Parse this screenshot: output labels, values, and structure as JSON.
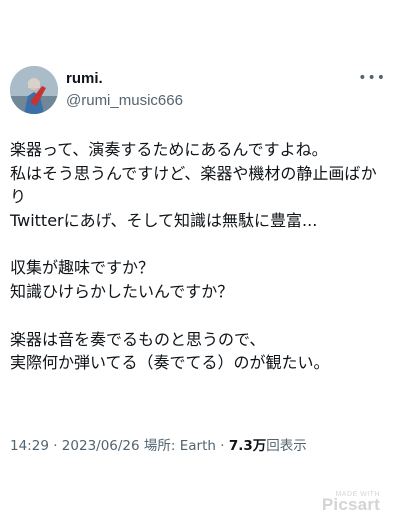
{
  "author": {
    "display_name": "rumi.",
    "handle": "@rumi_music666"
  },
  "more_icon": "ellipsis-icon",
  "tweet": {
    "lines": [
      "楽器って、演奏するためにあるんですよね。",
      "私はそう思うんですけど、楽器や機材の静止画ばか",
      "り",
      "Twitterにあげ、そして知識は無駄に豊富...",
      "",
      "収集が趣味ですか？",
      "知識ひけらかしたいんですか？",
      "",
      "楽器は音を奏でるものと思うので、",
      "実際何か弾いてる（奏でてる）のが観たい。"
    ]
  },
  "meta": {
    "time": "14:29",
    "date": "2023/06/26",
    "location_label": "場所: Earth",
    "views_count": "7.3万",
    "views_label": "回表示",
    "separator": "·"
  },
  "watermark": {
    "made_with": "MADE WITH",
    "brand": "Picsart"
  },
  "colors": {
    "text_primary": "#0f1419",
    "text_secondary": "#536471",
    "background": "#ffffff"
  }
}
